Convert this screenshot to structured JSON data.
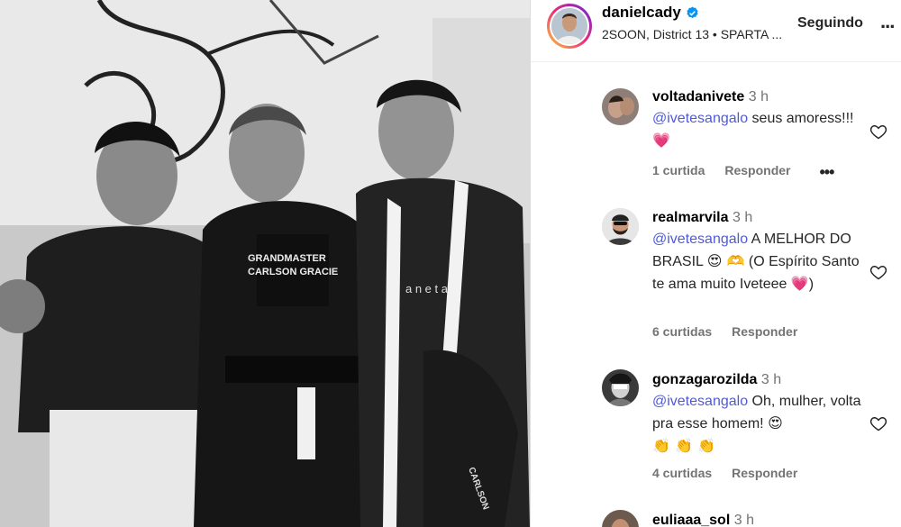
{
  "post": {
    "username": "danielcady",
    "location": "2SOON, District 13 • SPARTA ...",
    "follow_label": "Seguindo",
    "more_label": "..."
  },
  "photo": {
    "shirt_text_1": "GRANDMASTER",
    "shirt_text_2": "CARLSON GRACIE",
    "shirt_text_3": "a n e t a",
    "belt_text": "CARLSON"
  },
  "comments": [
    {
      "username": "voltadanivete",
      "time": "3 h",
      "mention": "@ivetesangalo",
      "text_1": " seus amoress!!! ",
      "emoji_1": "💗",
      "likes": "1 curtida",
      "reply": "Responder",
      "more": "•••"
    },
    {
      "username": "realmarvila",
      "time": "3 h",
      "mention": "@ivetesangalo",
      "text_1": " A MELHOR DO BRASIL ",
      "emoji_1": "😍 🫶",
      "text_2": " (O Espírito Santo te ama muito Iveteee ",
      "emoji_2": "💗",
      "text_3": ")",
      "likes": "6 curtidas",
      "reply": "Responder"
    },
    {
      "username": "gonzagarozilda",
      "time": "3 h",
      "mention": "@ivetesangalo",
      "text_1": " Oh, mulher, volta pra esse homem! ",
      "emoji_1": "😍",
      "emoji_2": "👏 👏 👏",
      "likes": "4 curtidas",
      "reply": "Responder"
    },
    {
      "username": "euliaaa_sol",
      "time": "3 h"
    }
  ],
  "colors": {
    "mention": "#4f5bd5",
    "meta": "#737373",
    "heart": "#e0245e"
  }
}
